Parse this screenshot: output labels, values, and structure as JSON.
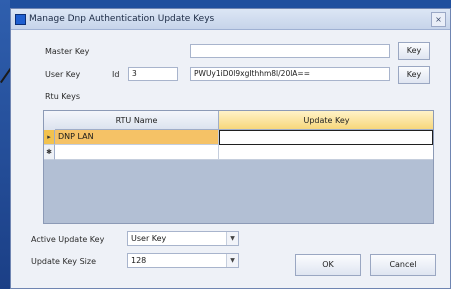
{
  "window": {
    "title": "Manage Dnp Authentication Update Keys"
  },
  "master_key": {
    "label": "Master Key",
    "value": "",
    "button": "Key"
  },
  "user_key": {
    "label": "User Key",
    "id_label": "Id",
    "id_value": "3",
    "value": "PWUy1iD0l9xgIthhm8l/20lA==",
    "button": "Key"
  },
  "rtu_keys": {
    "label": "Rtu Keys",
    "columns": [
      "RTU Name",
      "Update Key"
    ],
    "rows": [
      {
        "indicator": "▸",
        "rtu_name": "DNP LAN",
        "update_key": ""
      },
      {
        "indicator": "✱",
        "rtu_name": "",
        "update_key": ""
      }
    ]
  },
  "active_update_key": {
    "label": "Active Update Key",
    "value": "User Key",
    "arrow": "▼"
  },
  "update_key_size": {
    "label": "Update Key Size",
    "value": "128",
    "arrow": "▼"
  },
  "buttons": {
    "ok": "OK",
    "cancel": "Cancel"
  },
  "icons": {
    "close": "×"
  }
}
